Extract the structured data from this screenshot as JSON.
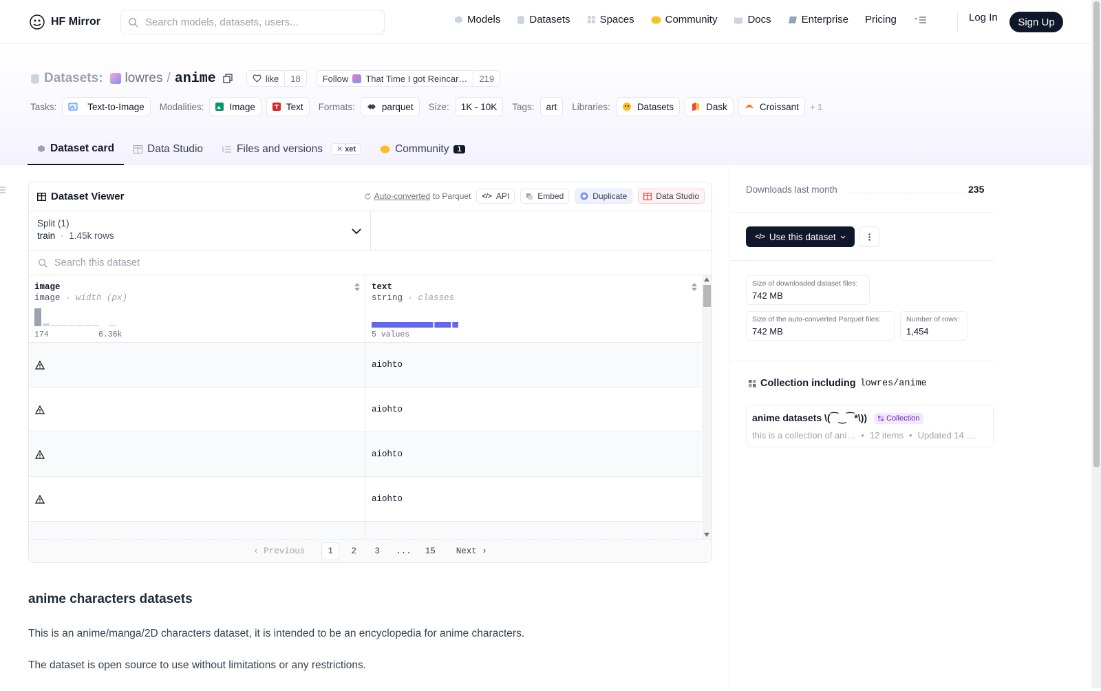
{
  "nav": {
    "brand": "HF Mirror",
    "search_placeholder": "Search models, datasets, users...",
    "links": [
      {
        "label": "Models",
        "icon": "models-icon"
      },
      {
        "label": "Datasets",
        "icon": "datasets-icon"
      },
      {
        "label": "Spaces",
        "icon": "spaces-icon"
      },
      {
        "label": "Community",
        "icon": "community-icon"
      },
      {
        "label": "Docs",
        "icon": "docs-icon"
      },
      {
        "label": "Enterprise",
        "icon": "enterprise-icon"
      },
      {
        "label": "Pricing"
      }
    ],
    "login": "Log In",
    "signup": "Sign Up"
  },
  "header": {
    "prefix": "Datasets:",
    "owner": "lowres",
    "separator": "/",
    "name": "anime",
    "like_label": "like",
    "like_count": "18",
    "follow_label": "Follow",
    "follow_org": "That Time I got Reincar…",
    "follow_count": "219",
    "tags": {
      "tasks_label": "Tasks:",
      "task": "Text-to-Image",
      "modalities_label": "Modalities:",
      "modality_1": "Image",
      "modality_2": "Text",
      "formats_label": "Formats:",
      "format": "parquet",
      "size_label": "Size:",
      "size": "1K - 10K",
      "tags_label": "Tags:",
      "tag": "art",
      "libraries_label": "Libraries:",
      "lib_1": "Datasets",
      "lib_2": "Dask",
      "lib_3": "Croissant",
      "more": "+ 1"
    },
    "tabs": {
      "card": "Dataset card",
      "studio": "Data Studio",
      "files": "Files and versions",
      "xet": "xet",
      "community": "Community",
      "community_count": "1"
    }
  },
  "viewer": {
    "title": "Dataset Viewer",
    "auto_converted": "Auto-converted",
    "to_parquet": "to Parquet",
    "api": "API",
    "embed": "Embed",
    "duplicate": "Duplicate",
    "data_studio": "Data Studio",
    "split_label": "Split (1)",
    "split_name": "train",
    "split_dot": "·",
    "split_rows": "1.45k rows",
    "search_placeholder": "Search this dataset",
    "col1": {
      "name": "image",
      "type": "image",
      "stat": "· width (px)",
      "min": "174",
      "max": "6.36k"
    },
    "col2": {
      "name": "text",
      "type": "string",
      "stat": "· classes",
      "values": "5 values"
    },
    "rows": [
      "aiohto",
      "aiohto",
      "aiohto",
      "aiohto"
    ],
    "pager": {
      "prev": "Previous",
      "pages": [
        "1",
        "2",
        "3",
        "...",
        "15"
      ],
      "next": "Next"
    }
  },
  "card": {
    "heading": "anime characters datasets",
    "p1": "This is an anime/manga/2D characters dataset, it is intended to be an encyclopedia for anime characters.",
    "p2": "The dataset is open source to use without limitations or any restrictions."
  },
  "sidebar": {
    "downloads_label": "Downloads last month",
    "downloads_value": "235",
    "use_dataset": "Use this dataset",
    "size_dl_label": "Size of downloaded dataset files:",
    "size_dl_value": "742 MB",
    "size_pq_label": "Size of the auto-converted Parquet files:",
    "size_pq_value": "742 MB",
    "rows_label": "Number of rows:",
    "rows_value": "1,454",
    "collection_prefix": "Collection including",
    "collection_repo": "lowres/anime",
    "coll_title": "anime datasets \\(⁀‿⁀*\\))",
    "coll_badge": "Collection",
    "coll_desc": "this is a collection of ani…",
    "coll_items": "12 items",
    "coll_updated": "Updated 14 …",
    "coll_dot": "•"
  },
  "colors": {
    "accent": "#6366f1",
    "dark": "#0f172a",
    "studio_red": "#ef4444"
  },
  "chart_data": {
    "type": "bar",
    "title": "",
    "series": [
      {
        "column": "image",
        "values": [
          100,
          16,
          4,
          4,
          4,
          4,
          4,
          4,
          0,
          4
        ]
      },
      {
        "column": "text",
        "values": [
          60,
          17,
          7
        ]
      }
    ]
  }
}
